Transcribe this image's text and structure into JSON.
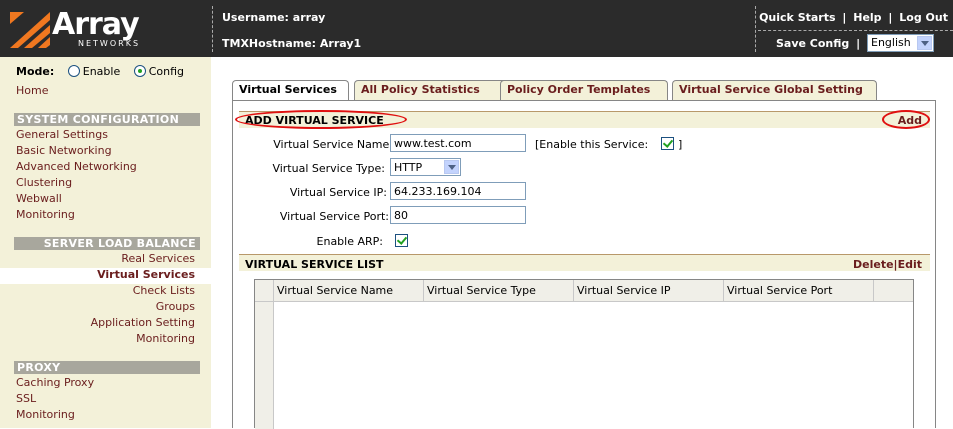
{
  "header": {
    "brand": "Array",
    "brand_sub": "NETWORKS",
    "username": "Username: array",
    "hostname": "TMXHostname: Array1",
    "quick_starts": "Quick Starts",
    "help": "Help",
    "logout": "Log Out",
    "link_sep": "|",
    "save_config": "Save Config",
    "language": "English"
  },
  "sidebar": {
    "mode_label": "Mode:",
    "mode_enable": "Enable",
    "mode_config": "Config",
    "mode_selected": "Config",
    "home": "Home",
    "system_config": {
      "title": "SYSTEM CONFIGURATION",
      "items": [
        "General Settings",
        "Basic Networking",
        "Advanced Networking",
        "Clustering",
        "Webwall",
        "Monitoring"
      ]
    },
    "slb": {
      "title": "SERVER LOAD BALANCE",
      "items": [
        "Real Services",
        "Virtual Services",
        "Check Lists",
        "Groups",
        "Application Setting",
        "Monitoring"
      ],
      "active": "Virtual Services"
    },
    "proxy": {
      "title": "PROXY",
      "items": [
        "Caching Proxy",
        "SSL",
        "Monitoring"
      ]
    }
  },
  "tabs": [
    "Virtual Services",
    "All Policy Statistics",
    "Policy Order Templates",
    "Virtual Service Global Setting"
  ],
  "active_tab": "Virtual Services",
  "add_section": {
    "title": "ADD VIRTUAL SERVICE",
    "action": "Add",
    "fields": {
      "name_label": "Virtual Service Name:",
      "name_value": "www.test.com",
      "enable_label": "[Enable this Service:",
      "enable_close": "]",
      "enable_checked": true,
      "type_label": "Virtual Service Type:",
      "type_value": "HTTP",
      "ip_label": "Virtual Service IP:",
      "ip_value": "64.233.169.104",
      "port_label": "Virtual Service Port:",
      "port_value": "80",
      "arp_label": "Enable ARP:",
      "arp_checked": true
    }
  },
  "list_section": {
    "title": "VIRTUAL SERVICE LIST",
    "delete": "Delete",
    "sep": "|",
    "edit": "Edit",
    "columns": [
      "Virtual Service Name",
      "Virtual Service Type",
      "Virtual Service IP",
      "Virtual Service Port"
    ],
    "rows": []
  },
  "colors": {
    "header_bg": "#2b2b2b",
    "sidebar_bg": "#f3f1d9",
    "link": "#6a1d1d",
    "brand_orange": "#f07820",
    "highlight_ring": "#e01010"
  }
}
